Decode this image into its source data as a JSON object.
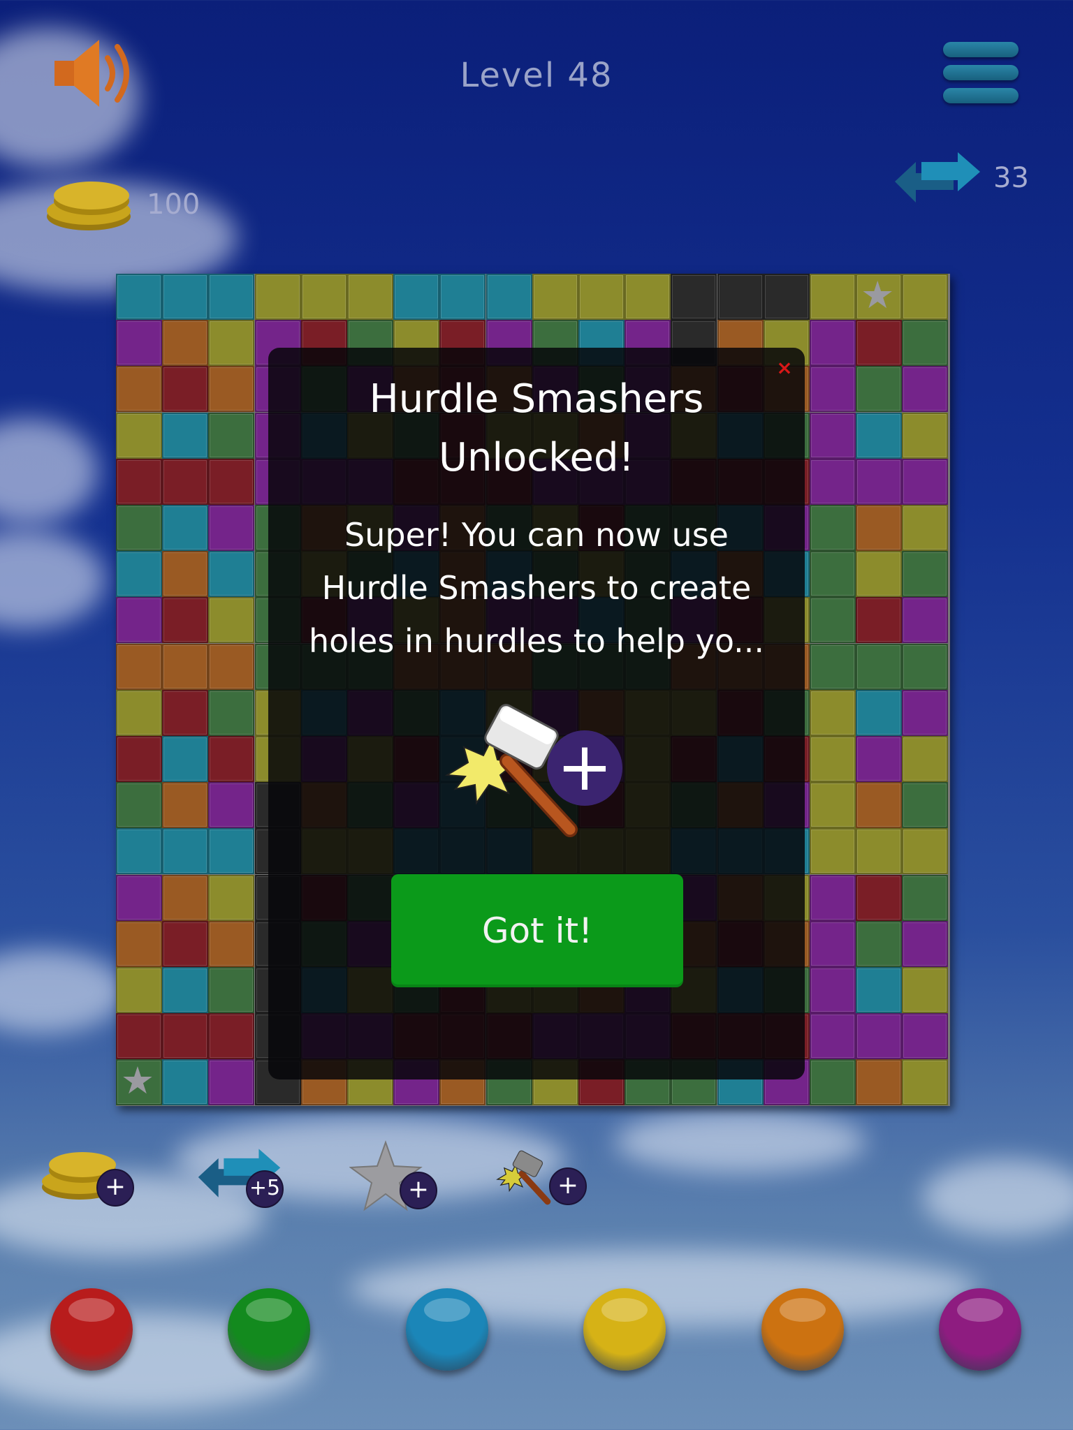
{
  "header": {
    "level_title": "Level 48",
    "coins": "100",
    "swaps": "33"
  },
  "board": {
    "rows": 18,
    "cols": 18,
    "colors": {
      "teal": "#1f7f94",
      "purple": "#74248a",
      "orange": "#9a5a23",
      "olive": "#8c8c2c",
      "red": "#7a1e26",
      "green": "#3c6e3e",
      "dark": "#2a2a2a"
    },
    "star_icon": "star-icon"
  },
  "modal": {
    "title_line1": "Hurdle Smashers",
    "title_line2": "Unlocked!",
    "body_line1": "Super!  You can now use",
    "body_line2": "Hurdle Smashers to create",
    "body_line3": "holes in hurdles to help yo...",
    "close_label": "×",
    "plus_label": "+",
    "button_label": "Got it!"
  },
  "powerups": {
    "coins_badge": "+",
    "swap_badge": "+5",
    "star_badge": "+",
    "hammer_badge": "+"
  },
  "color_balls": [
    {
      "name": "red",
      "color": "#b81c1c"
    },
    {
      "name": "green",
      "color": "#138a1e"
    },
    {
      "name": "blue",
      "color": "#1b86b8"
    },
    {
      "name": "yellow",
      "color": "#d6b216"
    },
    {
      "name": "orange",
      "color": "#cc7211"
    },
    {
      "name": "purple",
      "color": "#8e1c80"
    }
  ]
}
